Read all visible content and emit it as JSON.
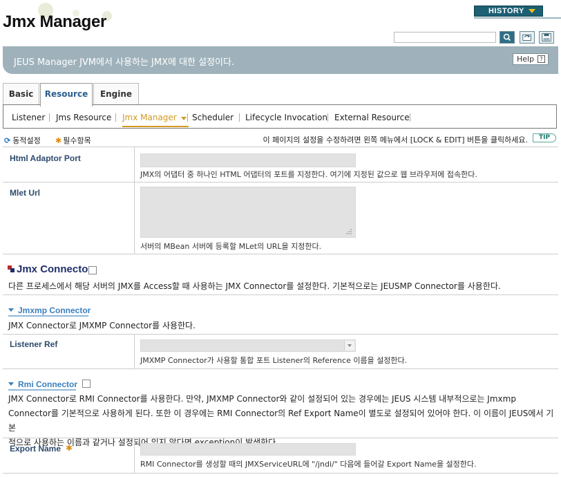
{
  "header": {
    "title": "Jmx Manager",
    "history_label": "HISTORY"
  },
  "banner": {
    "text": "JEUS Manager JVM에서 사용하는 JMX에 대한 설정이다.",
    "help_label": "Help",
    "help_icon": "?"
  },
  "tabs": [
    {
      "label": "Basic",
      "active": false
    },
    {
      "label": "Resource",
      "active": true
    },
    {
      "label": "Engine",
      "active": false
    }
  ],
  "subnav": [
    {
      "label": "Listener"
    },
    {
      "label": "Jms Resource"
    },
    {
      "label": "Jmx Manager",
      "active": true
    },
    {
      "label": "Scheduler"
    },
    {
      "label": "Lifecycle Invocation"
    },
    {
      "label": "External Resource"
    }
  ],
  "legend": {
    "dynamic": "동적설정",
    "required": "필수항목",
    "tip_text": "이 페이지의 설정을 수정하려면 왼쪽 메뉴에서 [LOCK & EDIT] 버튼을 클릭하세요.",
    "tip_badge": "TIP"
  },
  "fields": {
    "html_adaptor_port": {
      "label": "Html Adaptor Port",
      "value": "",
      "desc": "JMX의 어댑터 중 하나인 HTML 어댑터의 포트를 지정한다. 여기에 지정된 값으로 웹 브라우저에 접속한다."
    },
    "mlet_url": {
      "label": "Mlet Url",
      "value": "",
      "desc": "서버의 MBean 서버에 등록할 MLet의 URL을 지정한다."
    }
  },
  "jmx_connector": {
    "title": "Jmx Connector",
    "checked": false,
    "desc": "다른 프로세스에서 해당 서버의 JMX를 Access할 때 사용하는 JMX Connector를 설정한다. 기본적으로는 JEUSMP Connector를 사용한다.",
    "jmxmp": {
      "title": "Jmxmp Connector",
      "desc": "JMX Connector로 JMXMP Connector를 사용한다.",
      "listener_ref": {
        "label": "Listener Ref",
        "value": "",
        "desc": "JMXMP Connector가 사용할 통합 포트 Listener의 Reference 이름을 설정한다."
      }
    },
    "rmi": {
      "title": "Rmi Connector",
      "checked": false,
      "desc_lines": [
        "JMX Connector로 RMI Connector를 사용한다. 만약, JMXMP Connector와 같이 설정되어 있는 경우에는 JEUS 시스템 내부적으로는 Jmxmp",
        "Connector를 기본적으로 사용하게 된다. 또한 이 경우에는 RMI Connector의 Ref Export Name이 별도로 설정되어 있어야 한다. 이 이름이 JEUS에서 기본",
        "적으로 사용하는 이름과 같거나 설정되어 있지 않다면 exception이 발생한다."
      ],
      "export_name": {
        "label": "Export Name",
        "value": "",
        "desc": "RMI Connector를 생성할 때의 JMXServiceURL에 \"/jndi/\" 다음에 들어갈 Export Name을 설정한다."
      }
    }
  },
  "icons": {
    "search": "search-icon",
    "refresh": "refresh-icon",
    "save": "save-icon",
    "dynamic": "refresh-cycle-icon",
    "required": "asterisk-icon"
  },
  "colors": {
    "banner": "#9fb2bb",
    "active_tab": "#2b5d8c",
    "active_subnav": "#d39a1f",
    "history": "#1d5f73",
    "label": "#2d4a6c",
    "subsection": "#3a7fbe"
  }
}
